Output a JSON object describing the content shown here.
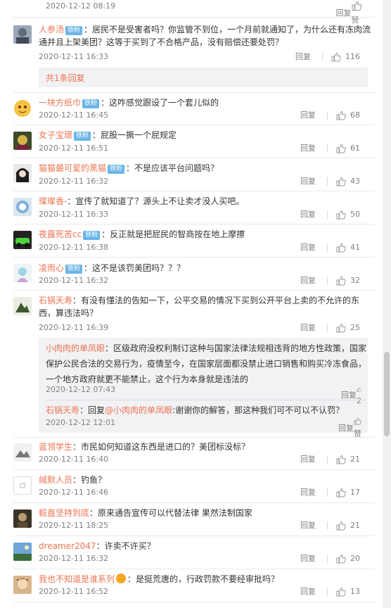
{
  "top_meta": {
    "time": "2020-12-12 08:19",
    "reply": "回复",
    "likes": "赞"
  },
  "comments": [
    {
      "user": "人参汤",
      "badge": "铁粉",
      "text": "：居民不是受害者吗？你监管不到位，一个月前就通知了，为什么还有冻肉流通并且上架美团？这等于买到了不合格产品，没有赔偿还要处罚？",
      "time": "2020-12-11 16:33",
      "reply": "回复",
      "likes": "116",
      "more": "共1条回复"
    },
    {
      "user": "一块方纸巾",
      "badge": "铁粉",
      "text": "：这咋感觉跟设了一个套儿似的",
      "time": "2020-12-11 16:45",
      "reply": "回复",
      "likes": "68"
    },
    {
      "user": "女子宝璟",
      "badge": "铁粉",
      "text": "：屁股一撅一个屁规定",
      "time": "2020-12-11 16:51",
      "reply": "回复",
      "likes": "61"
    },
    {
      "user": "猫猫最可爱的黑猫",
      "badge": "铁粉",
      "text": "：不是应该平台问题吗？",
      "time": "2020-12-11 16:32",
      "reply": "回复",
      "likes": "43"
    },
    {
      "user": "璨璨香-",
      "text": "：宣传了就知道了？源头上不让卖才没人买吧。",
      "time": "2020-12-11 16:33",
      "reply": "回复",
      "likes": "50"
    },
    {
      "user": "夜露死苦cc",
      "badge": "铁粉",
      "text": "：反正就是把屁民的智商按在地上摩擦",
      "time": "2020-12-11 16:38",
      "reply": "回复",
      "likes": "41"
    },
    {
      "user": "凌雨心",
      "badge": "铁粉",
      "text": "：这不是该罚美团吗？？？",
      "time": "2020-12-11 16:32",
      "reply": "回复",
      "likes": "32"
    },
    {
      "user": "石锅天寿",
      "text": "：有没有懂法的告知一下，公平交易的情况下买到公开平台上卖的不允许的东西，算违法吗？",
      "time": "2020-12-11 16:39",
      "reply": "回复",
      "likes": "25",
      "replies": [
        {
          "user": "小肉肉的单凤眼",
          "text": "：区级政府没权利制订这种与国家法律法规相违背的地方性政策，国家保护公民合法的交易行为，疫情至今，在国家层面都没禁止进口销售和购买冷冻食品，一个地方政府就更不能禁止，这个行为本身就是违法的",
          "time": "2020-12-12 07:43",
          "reply": "回复",
          "likes": "2"
        },
        {
          "user": "石锅天寿",
          "prefix": "：回复",
          "mention": "@小肉肉的单凤眼",
          "text": ":谢谢你的解答，那这种我们可不可以不认罚？",
          "time": "2020-12-12 12:01",
          "reply": "回复",
          "likes": "赞"
        }
      ]
    },
    {
      "user": "蓝领学生",
      "text": "：市民如何知道这东西是进口的？美团标没标？",
      "time": "2020-12-11 16:40",
      "reply": "回复",
      "likes": "21"
    },
    {
      "user": "缄默人员",
      "text": "：钓鱼？",
      "time": "2020-12-11 16:46",
      "reply": "回复",
      "likes": "17"
    },
    {
      "user": "毅直坚持到底",
      "text": "：原来通告宣传可以代替法律 果然法制国家",
      "time": "2020-12-11 18:25",
      "reply": "回复",
      "likes": "21"
    },
    {
      "user": "dreamer2047",
      "text": "：许卖不许买？",
      "time": "2020-12-11 16:32",
      "reply": "回复",
      "likes": "20"
    },
    {
      "user": "我也不知道是谁系列",
      "text": "：是挺荒唐的，行政罚款不要经审批吗？",
      "time": "2020-12-11 16:52",
      "reply": "回复",
      "likes": "13"
    }
  ]
}
